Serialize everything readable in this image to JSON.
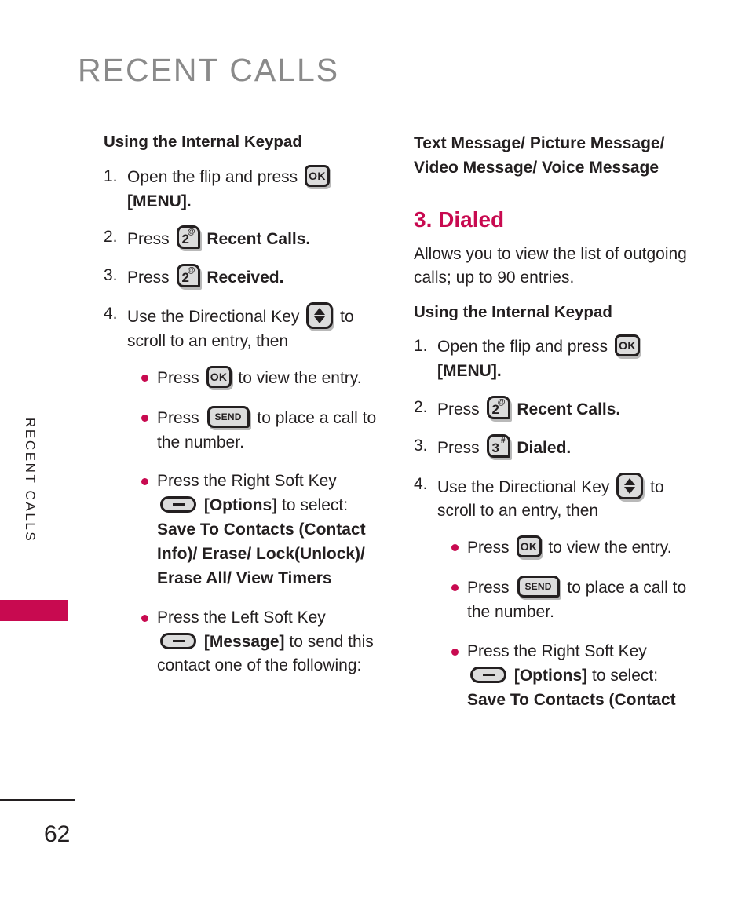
{
  "page": {
    "title": "RECENT CALLS",
    "side_tab_label": "RECENT CALLS",
    "page_number": "62",
    "accent_color": "#c80a50",
    "title_color": "#8a8a8a",
    "text_color": "#231f20",
    "key_fill_color": "#dcdcdc"
  },
  "left_column": {
    "subhead": "Using the Internal Keypad",
    "steps": [
      {
        "num": "1.",
        "text_before": "Open the flip and press",
        "key": "ok-key",
        "key_label": "OK",
        "text_after": "[MENU]."
      },
      {
        "num": "2.",
        "text_before": "Press",
        "key": "key-2",
        "key_label": "2",
        "key_sup": "@",
        "text_after": "Recent Calls."
      },
      {
        "num": "3.",
        "text_before": "Press",
        "key": "key-2",
        "key_label": "2",
        "key_sup": "@",
        "text_after": "Received."
      },
      {
        "num": "4.",
        "text_before": "Use the Directional Key",
        "key": "directional-key",
        "text_after": "to scroll to an entry, then"
      }
    ],
    "bullets": [
      {
        "text_before": "Press",
        "key": "ok-key",
        "key_label": "OK",
        "text_after": "to view the entry."
      },
      {
        "text_before": "Press",
        "key": "send-key",
        "key_label": "SEND",
        "text_after": "to place a call to the number."
      },
      {
        "text_before": "Press the Right Soft Key",
        "key": "soft-key",
        "bracket_label": "[Options]",
        "text_after": "to select:",
        "options": "Save To Contacts (Contact Info)/ Erase/ Lock(Unlock)/ Erase All/ View Timers"
      },
      {
        "text_before": "Press the Left Soft Key",
        "key": "soft-key",
        "bracket_label": "[Message]",
        "text_after": "to send this contact one of the following:"
      }
    ]
  },
  "right_column": {
    "message_types": "Text Message/ Picture Message/ Video Message/ Voice Message",
    "section_head": "3. Dialed",
    "description": "Allows you to view the list of outgoing calls; up to 90 entries.",
    "subhead": "Using the Internal Keypad",
    "steps": [
      {
        "num": "1.",
        "text_before": "Open the flip and press",
        "key": "ok-key",
        "key_label": "OK",
        "text_after": "[MENU]."
      },
      {
        "num": "2.",
        "text_before": "Press",
        "key": "key-2",
        "key_label": "2",
        "key_sup": "@",
        "text_after": "Recent Calls."
      },
      {
        "num": "3.",
        "text_before": "Press",
        "key": "key-3",
        "key_label": "3",
        "key_sup": "#",
        "text_after": "Dialed."
      },
      {
        "num": "4.",
        "text_before": "Use the Directional Key",
        "key": "directional-key",
        "text_after": "to scroll to an entry, then"
      }
    ],
    "bullets": [
      {
        "text_before": "Press",
        "key": "ok-key",
        "key_label": "OK",
        "text_after": "to view the entry."
      },
      {
        "text_before": "Press",
        "key": "send-key",
        "key_label": "SEND",
        "text_after": "to place a call to the number."
      },
      {
        "text_before": "Press the Right Soft Key",
        "key": "soft-key",
        "bracket_label": "[Options]",
        "text_after": "to select:",
        "options": "Save To Contacts (Contact"
      }
    ]
  }
}
